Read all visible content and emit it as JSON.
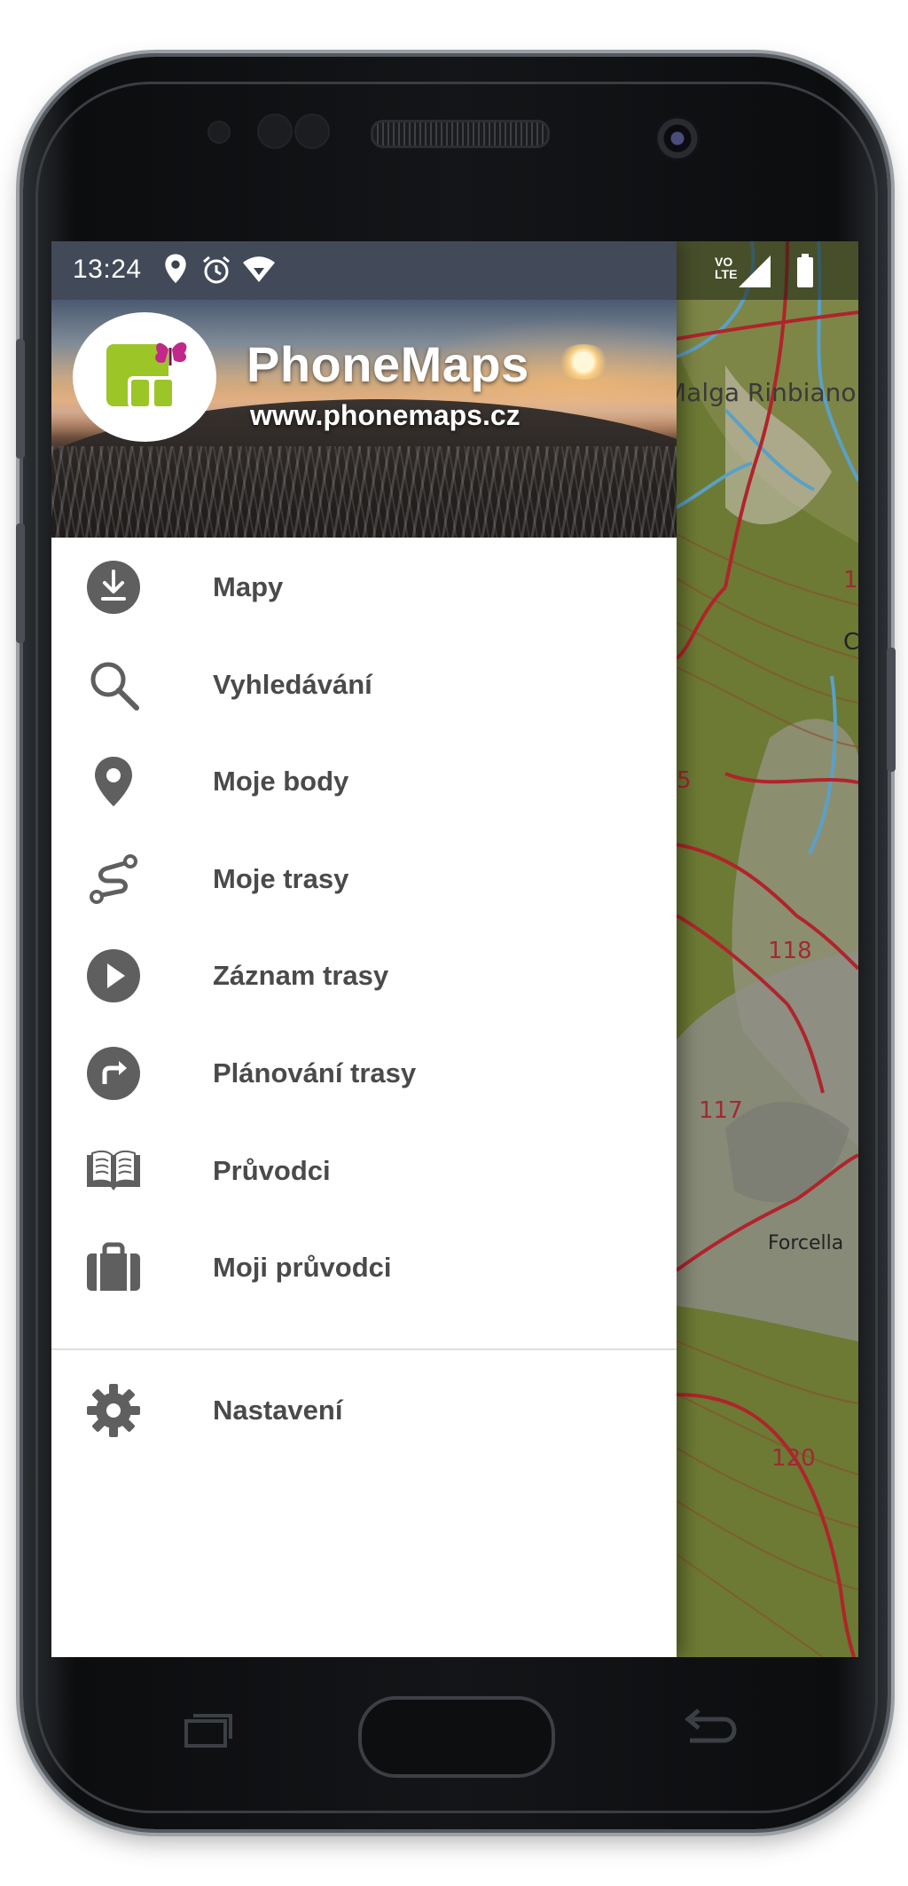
{
  "status_bar": {
    "time": "13:24",
    "network_label": "VO\nLTE",
    "right_icons": [
      "signal-icon",
      "battery-icon"
    ]
  },
  "header": {
    "app_name": "PhoneMaps",
    "url": "www.phonemaps.cz"
  },
  "menu": [
    {
      "label": "Mapy",
      "icon": "download-icon"
    },
    {
      "label": "Vyhledávání",
      "icon": "search-icon"
    },
    {
      "label": "Moje body",
      "icon": "pin-icon"
    },
    {
      "label": "Moje trasy",
      "icon": "route-icon"
    },
    {
      "label": "Záznam trasy",
      "icon": "play-icon"
    },
    {
      "label": "Plánování trasy",
      "icon": "turn-right-icon"
    },
    {
      "label": "Průvodci",
      "icon": "book-icon"
    },
    {
      "label": "Moji průvodci",
      "icon": "briefcase-icon"
    }
  ],
  "settings": {
    "label": "Nastavení",
    "icon": "gear-icon"
  },
  "map_labels": {
    "place1": "Malga Rinbiano",
    "place2": "Forcella",
    "e118": "118",
    "e117": "117",
    "e120": "120",
    "edge1": "1",
    "edge2": "C",
    "edge3": "5"
  },
  "colors": {
    "icon_grey": "#5f5f5f",
    "text_grey": "#4a4a4a",
    "trail_red": "#b0242b",
    "water_blue": "#5aa0c8",
    "logo_green": "#9cc528",
    "logo_magenta": "#c2278a"
  }
}
